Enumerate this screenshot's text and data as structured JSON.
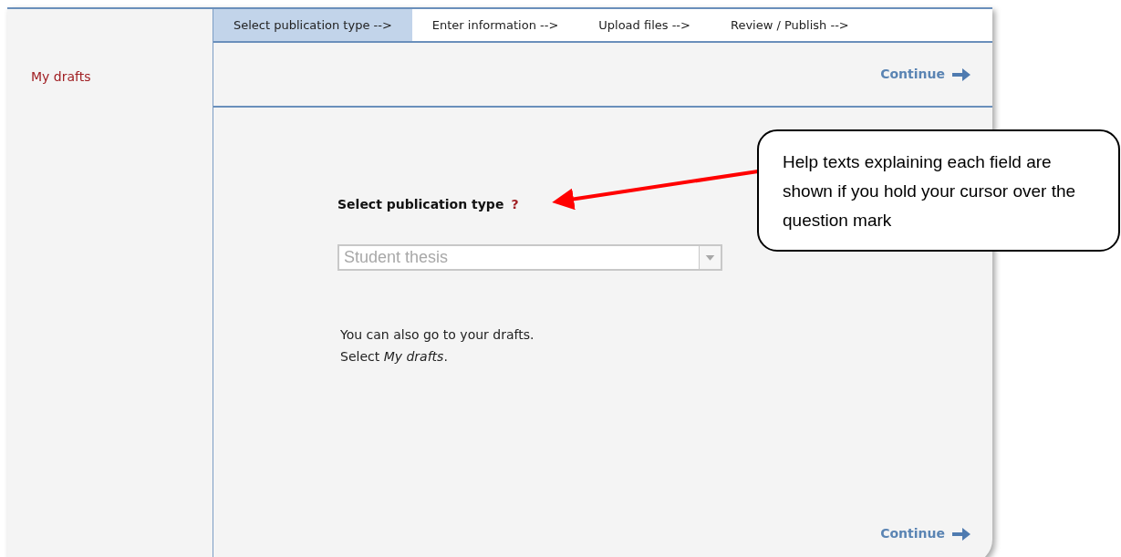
{
  "sidebar": {
    "items": [
      {
        "label": "My drafts"
      }
    ]
  },
  "steps": [
    {
      "label": "Select publication type -->",
      "selected": true
    },
    {
      "label": "Enter information -->",
      "selected": false
    },
    {
      "label": "Upload files -->",
      "selected": false
    },
    {
      "label": "Review / Publish -->",
      "selected": false
    }
  ],
  "top_action": {
    "label": "Continue"
  },
  "form": {
    "label": "Select publication type",
    "help": "?",
    "select": {
      "value": "Student thesis",
      "disabled": true
    }
  },
  "note": [
    "You can also go to your drafts.",
    "Select *My drafts*."
  ],
  "bottom_action": {
    "label": "Continue"
  },
  "callout": {
    "text": "Help texts explaining each field are shown if you hold your cursor over the question mark"
  }
}
